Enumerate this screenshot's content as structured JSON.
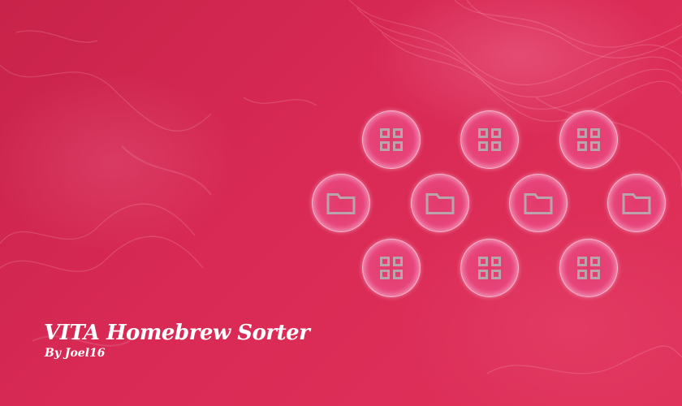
{
  "header": {
    "title": "VITA Homebrew Sorter",
    "author": "By Joel16"
  },
  "icons": [
    {
      "name": "grid-icon",
      "row": 1
    },
    {
      "name": "grid-icon",
      "row": 1
    },
    {
      "name": "grid-icon",
      "row": 1
    },
    {
      "name": "folder-icon",
      "row": 2
    },
    {
      "name": "folder-icon",
      "row": 2
    },
    {
      "name": "folder-icon",
      "row": 2
    },
    {
      "name": "folder-icon",
      "row": 2
    },
    {
      "name": "grid-icon",
      "row": 3
    },
    {
      "name": "grid-icon",
      "row": 3
    },
    {
      "name": "grid-icon",
      "row": 3
    }
  ],
  "colors": {
    "background": "#d92a55",
    "bubble": "#e7447a",
    "glyph": "#b9a4ae",
    "text": "#ffffff"
  }
}
